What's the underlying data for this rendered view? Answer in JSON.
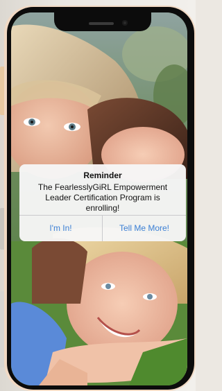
{
  "alert": {
    "title": "Reminder",
    "message": "The FearlesslyGiRL Empowerment Leader Certification Program is enrolling!",
    "primary_button": "I'm In!",
    "secondary_button": "Tell Me More!"
  },
  "colors": {
    "button_text": "#3b7fd4",
    "phone_frame": "#0c0c0c",
    "phone_bezel": "#f1d9c4"
  }
}
